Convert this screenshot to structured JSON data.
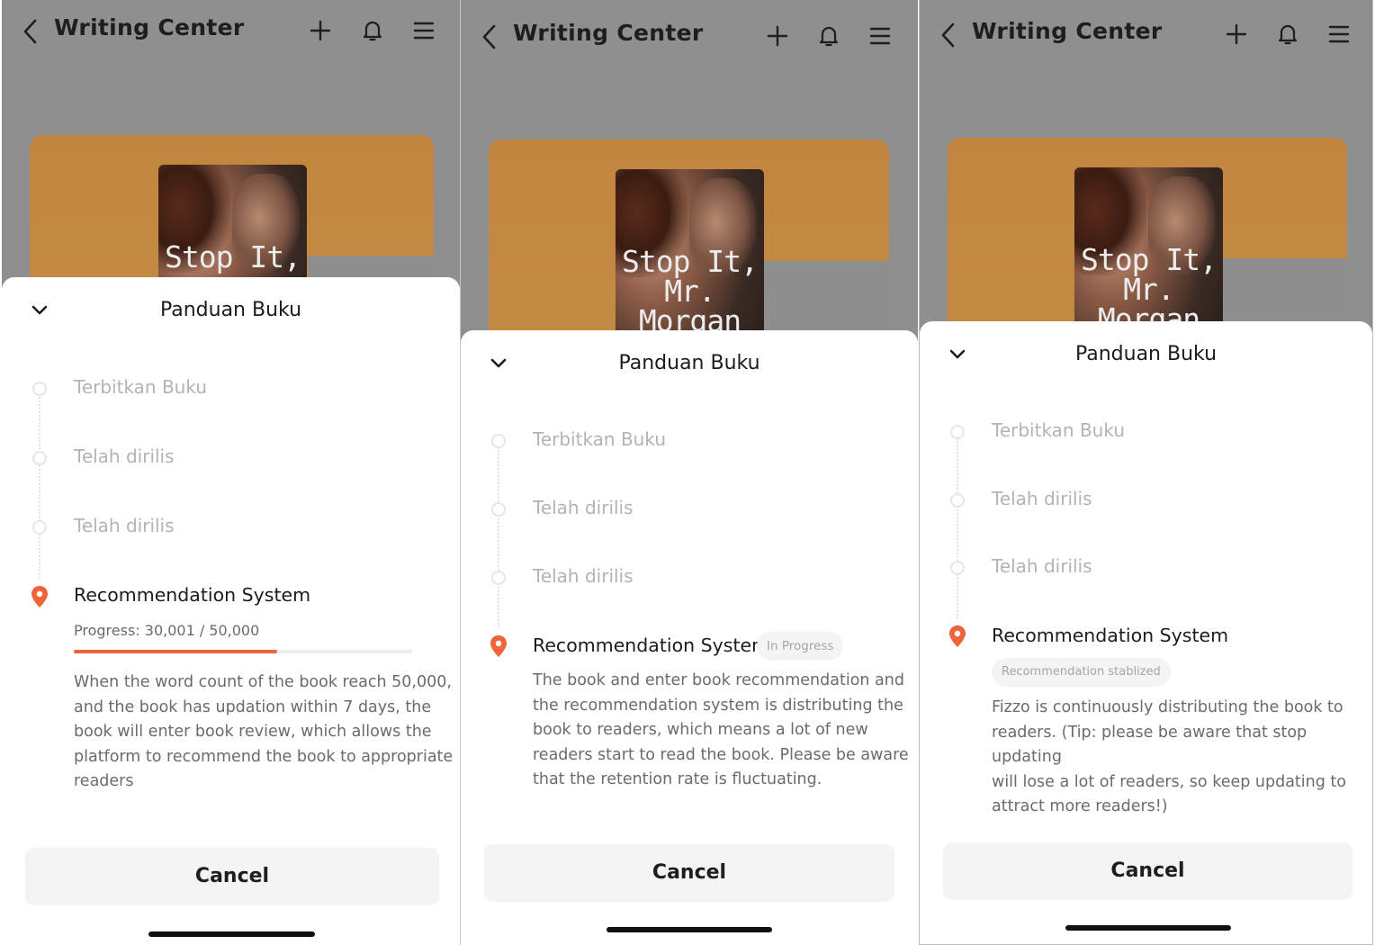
{
  "header": {
    "title": "Writing Center"
  },
  "book": {
    "cover_title_lines": [
      "Stop It,",
      "Mr.",
      "Morgan"
    ]
  },
  "sheet": {
    "title": "Panduan Buku",
    "steps": [
      "Terbitkan Buku",
      "Telah dirilis",
      "Telah dirilis"
    ],
    "current_step": "Recommendation System",
    "cancel_label": "Cancel"
  },
  "panels": [
    {
      "progress_text": "Progress: 30,001 / 50,000",
      "progress_value": 30001,
      "progress_max": 50000,
      "desc_lines": [
        "When the word count of the book reach 50,000,",
        "and the book has updation within 7 days, the",
        "book will enter book review, which allows the",
        "platform to recommend the book to appropriate",
        "readers"
      ]
    },
    {
      "badge": "In Progress",
      "desc_lines": [
        "The book and enter book recommendation and",
        "the recommendation system is distributing the",
        "book to readers, which means a lot of new",
        "readers start to read the book. Please be aware",
        "that the retention rate is fluctuating."
      ]
    },
    {
      "badge": "Recommendation stablized",
      "desc_lines": [
        "Fizzo is continuously distributing the book to",
        "readers. (Tip: please be aware that stop updating",
        "will lose a lot of readers, so keep updating to",
        "attract more readers!)"
      ]
    }
  ],
  "colors": {
    "accent": "#f0643a",
    "backdrop": "#8f8f8f",
    "card": "#c2853e",
    "button_bg": "#f4f4f4"
  },
  "icons": [
    "back-icon",
    "plus-icon",
    "bell-icon",
    "menu-icon",
    "chevron-down-icon",
    "location-pin-icon"
  ]
}
